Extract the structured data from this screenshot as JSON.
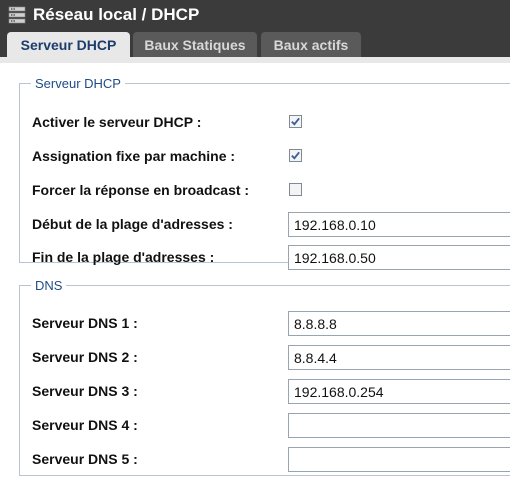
{
  "window": {
    "title": "Réseau local / DHCP"
  },
  "tabs": [
    {
      "label": "Serveur DHCP",
      "active": true
    },
    {
      "label": "Baux Statiques",
      "active": false
    },
    {
      "label": "Baux actifs",
      "active": false
    }
  ],
  "dhcp_section": {
    "legend": "Serveur DHCP",
    "fields": {
      "enable_server": {
        "label": "Activer le serveur DHCP :",
        "checked": true
      },
      "fixed_assignment": {
        "label": "Assignation fixe par machine :",
        "checked": true
      },
      "force_broadcast": {
        "label": "Forcer la réponse en broadcast :",
        "checked": false
      },
      "range_start": {
        "label": "Début de la plage d'adresses :",
        "value": "192.168.0.10"
      },
      "range_end": {
        "label": "Fin de la plage d'adresses :",
        "value": "192.168.0.50"
      }
    }
  },
  "dns_section": {
    "legend": "DNS",
    "servers": [
      {
        "label": "Serveur DNS 1 :",
        "value": "8.8.8.8"
      },
      {
        "label": "Serveur DNS 2 :",
        "value": "8.8.4.4"
      },
      {
        "label": "Serveur DNS 3 :",
        "value": "192.168.0.254"
      },
      {
        "label": "Serveur DNS 4 :",
        "value": ""
      },
      {
        "label": "Serveur DNS 5 :",
        "value": ""
      }
    ]
  },
  "icons": {
    "app": "network-server-icon",
    "check": "checkmark-icon"
  },
  "colors": {
    "header_bg": "#3b3b3b",
    "active_tab_bg": "#e8e8e8",
    "active_tab_text": "#1c3c6c",
    "inactive_tab_bg": "#5a5a5a",
    "legend_text": "#1f4d84",
    "checkmark": "#3a5f9a"
  }
}
